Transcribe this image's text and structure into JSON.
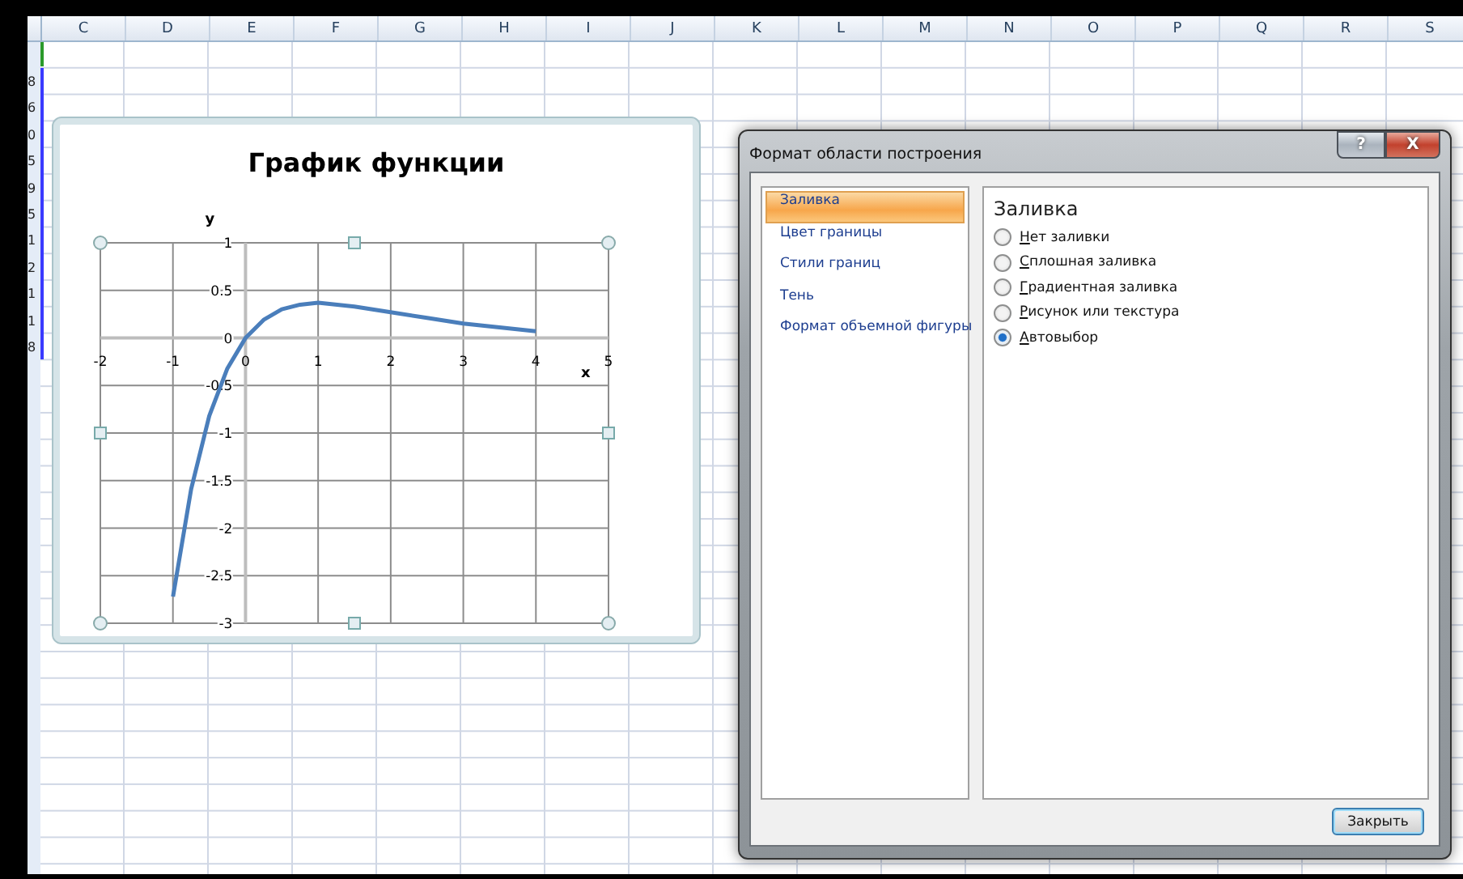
{
  "sheet": {
    "columns": [
      "C",
      "D",
      "E",
      "F",
      "G",
      "H",
      "I",
      "J",
      "K",
      "L",
      "M",
      "N",
      "O",
      "P",
      "Q",
      "R",
      "S"
    ],
    "row_header_fragments": [
      "8",
      "6",
      "0",
      "5",
      "9",
      "5",
      "1",
      "2",
      "1",
      "1",
      "8"
    ]
  },
  "chart": {
    "title": "График функции",
    "chart_data": {
      "type": "line",
      "xlabel": "x",
      "ylabel": "y",
      "x": [
        -1,
        -0.75,
        -0.5,
        -0.25,
        0,
        0.25,
        0.5,
        0.75,
        1,
        1.5,
        2,
        2.5,
        3,
        3.5,
        4
      ],
      "series": [
        {
          "color": "#4a7ebb",
          "values": [
            -2.72,
            -1.59,
            -0.82,
            -0.32,
            0,
            0.19,
            0.3,
            0.35,
            0.37,
            0.33,
            0.27,
            0.21,
            0.15,
            0.11,
            0.07
          ]
        }
      ],
      "xlim": [
        -2,
        5
      ],
      "ylim": [
        -3,
        1
      ],
      "grid": true,
      "xticks": [
        -2,
        -1,
        0,
        1,
        2,
        3,
        4,
        5
      ],
      "yticks": [
        {
          "value": 1,
          "label": "1"
        },
        {
          "value": 0.5,
          "label": "0.5"
        },
        {
          "value": 0,
          "label": "0"
        },
        {
          "value": -0.5,
          "label": "-0.5"
        },
        {
          "value": -1,
          "label": "-1"
        },
        {
          "value": -1.5,
          "label": "-1.5"
        },
        {
          "value": -2,
          "label": "-2"
        },
        {
          "value": -2.5,
          "label": "-2.5"
        },
        {
          "value": -3,
          "label": "-3"
        }
      ]
    }
  },
  "dialog": {
    "title": "Формат области построения",
    "help_button": "?",
    "close_button": "X",
    "categories": [
      {
        "label": "Заливка",
        "selected": true
      },
      {
        "label": "Цвет границы",
        "selected": false
      },
      {
        "label": "Стили границ",
        "selected": false
      },
      {
        "label": "Тень",
        "selected": false
      },
      {
        "label": "Формат объемной фигуры",
        "selected": false
      }
    ],
    "section_title": "Заливка",
    "options": [
      {
        "label": "Нет заливки",
        "selected": false
      },
      {
        "label": "Сплошная заливка",
        "selected": false
      },
      {
        "label": "Градиентная заливка",
        "selected": false
      },
      {
        "label": "Рисунок или текстура",
        "selected": false
      },
      {
        "label": "Автовыбор",
        "selected": true
      }
    ],
    "footer_button": "Закрыть"
  }
}
